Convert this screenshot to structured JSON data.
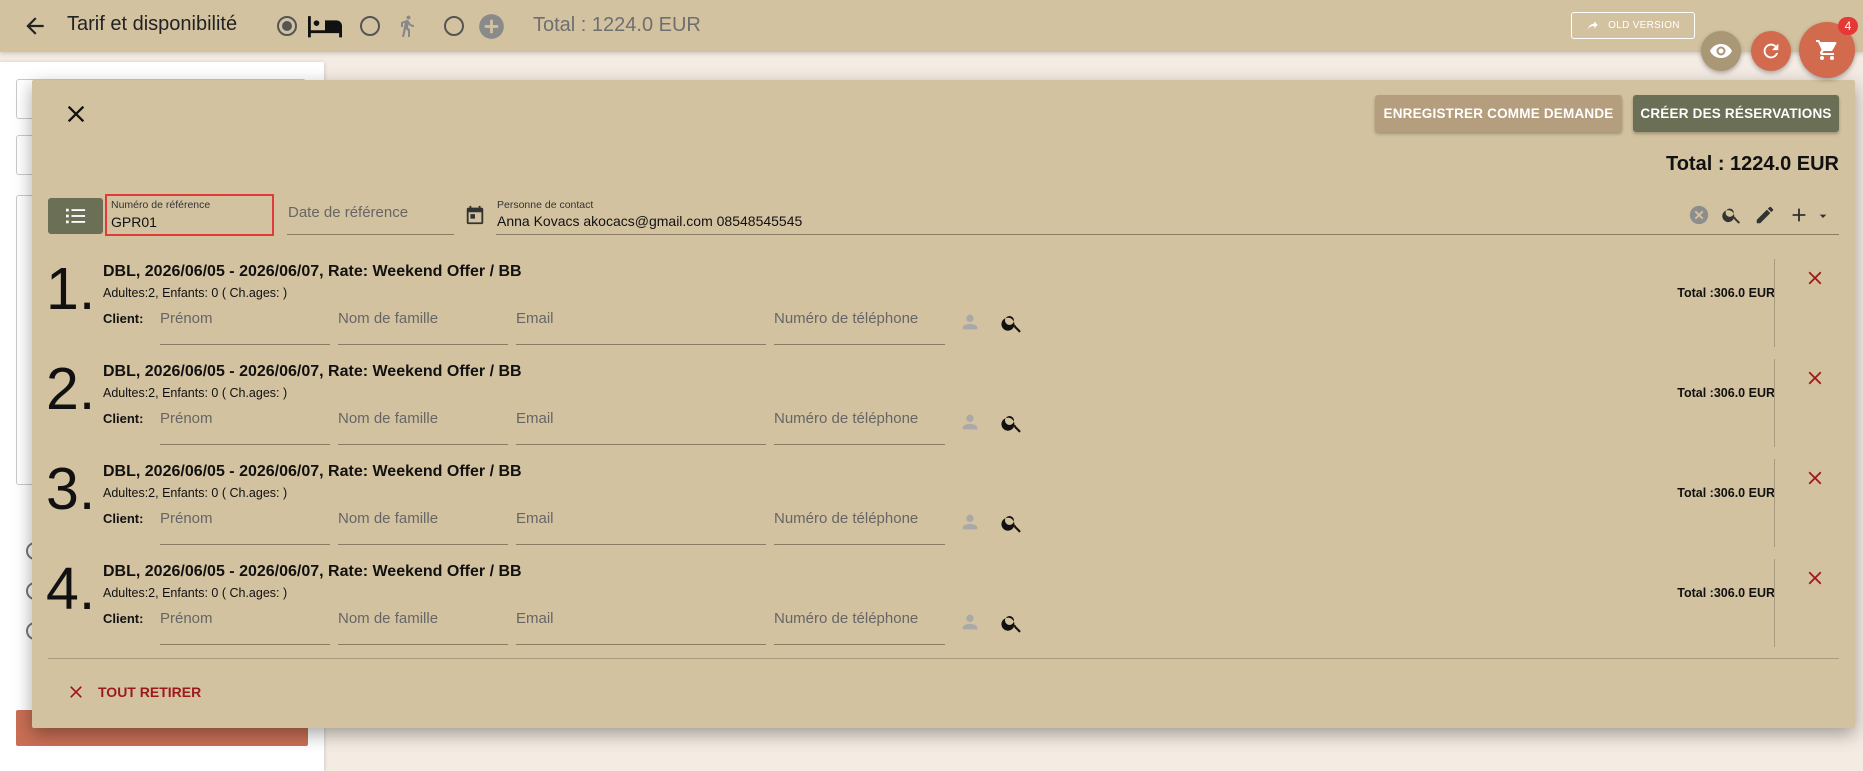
{
  "header": {
    "title": "Tarif et disponibilité",
    "total": "Total : 1224.0 EUR",
    "old_version": "OLD VERSION",
    "cart_count": "4",
    "accent_color": "#d3c2a0"
  },
  "dialog": {
    "save_request_label": "ENREGISTRER COMME DEMANDE",
    "create_label": "CRÉER DES RÉSERVATIONS",
    "total": "Total : 1224.0 EUR",
    "reference": {
      "label": "Numéro de référence",
      "value": "GPR01"
    },
    "reference_date": {
      "placeholder": "Date de référence"
    },
    "contact": {
      "label": "Personne de contact",
      "value": "Anna Kovacs akocacs@gmail.com 08548545545"
    },
    "client_label": "Client:",
    "placeholders": {
      "first_name": "Prénom",
      "last_name": "Nom de famille",
      "email": "Email",
      "phone": "Numéro de téléphone"
    },
    "reservations": [
      {
        "number": "1",
        "title": "DBL, 2026/06/05 - 2026/06/07, Rate: Weekend Offer / BB",
        "guests": "Adultes:2, Enfants: 0 ( Ch.ages: )",
        "total": "Total :306.0 EUR"
      },
      {
        "number": "2",
        "title": "DBL, 2026/06/05 - 2026/06/07, Rate: Weekend Offer / BB",
        "guests": "Adultes:2, Enfants: 0 ( Ch.ages: )",
        "total": "Total :306.0 EUR"
      },
      {
        "number": "3",
        "title": "DBL, 2026/06/05 - 2026/06/07, Rate: Weekend Offer / BB",
        "guests": "Adultes:2, Enfants: 0 ( Ch.ages: )",
        "total": "Total :306.0 EUR"
      },
      {
        "number": "4",
        "title": "DBL, 2026/06/05 - 2026/06/07, Rate: Weekend Offer / BB",
        "guests": "Adultes:2, Enfants: 0 ( Ch.ages: )",
        "total": "Total :306.0 EUR"
      }
    ],
    "remove_all_label": "TOUT RETIRER"
  }
}
